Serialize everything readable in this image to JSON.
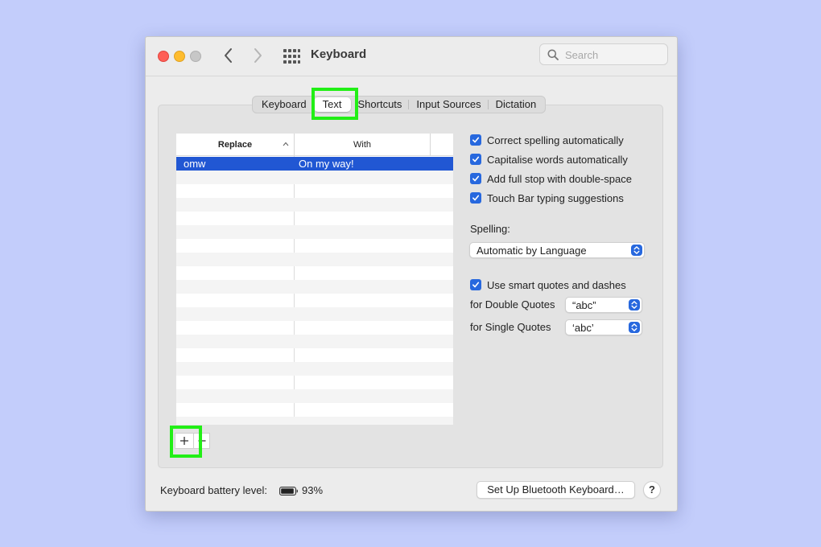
{
  "window": {
    "title": "Keyboard",
    "search_placeholder": "Search"
  },
  "tabs": [
    {
      "label": "Keyboard"
    },
    {
      "label": "Text",
      "active": true
    },
    {
      "label": "Shortcuts"
    },
    {
      "label": "Input Sources"
    },
    {
      "label": "Dictation"
    }
  ],
  "table": {
    "col_replace": "Replace",
    "col_with": "With",
    "rows": [
      {
        "replace": "omw",
        "with": "On my way!",
        "selected": true
      }
    ]
  },
  "options": {
    "correct_spelling": "Correct spelling automatically",
    "capitalise_words": "Capitalise words automatically",
    "full_stop": "Add full stop with double-space",
    "touch_bar": "Touch Bar typing suggestions",
    "spelling_label": "Spelling:",
    "spelling_value": "Automatic by Language",
    "smart_quotes": "Use smart quotes and dashes",
    "double_quotes_label": "for Double Quotes",
    "double_quotes_value": "“abc”",
    "single_quotes_label": "for Single Quotes",
    "single_quotes_value": "‘abc’"
  },
  "footer": {
    "battery_label": "Keyboard battery level:",
    "battery_percent": "93%",
    "bluetooth_button": "Set Up Bluetooth Keyboard…",
    "help_label": "?"
  },
  "colors": {
    "accent": "#2768de",
    "selection": "#2157d3",
    "highlight": "#22ef16",
    "desktop": "#c3cdfb"
  }
}
